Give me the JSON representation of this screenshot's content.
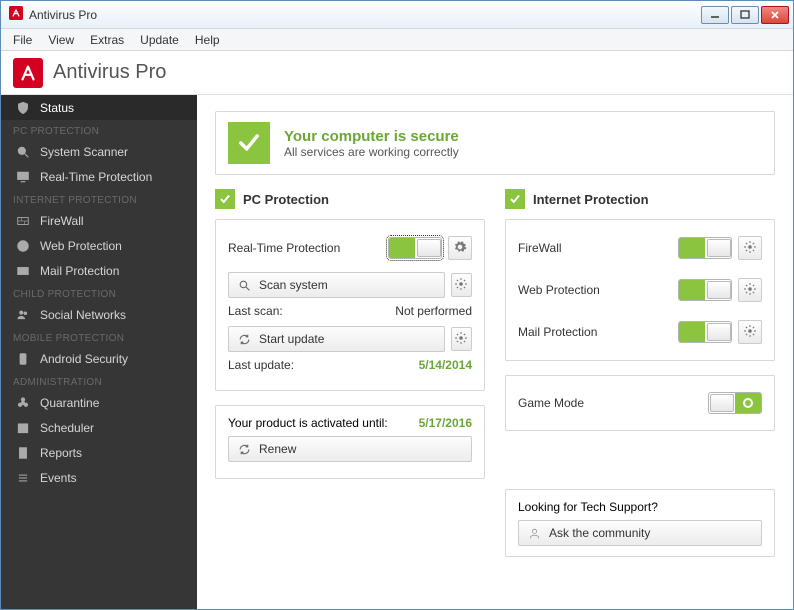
{
  "window": {
    "title": "Antivirus Pro"
  },
  "menubar": [
    "File",
    "View",
    "Extras",
    "Update",
    "Help"
  ],
  "header": {
    "app_name": "Antivirus Pro"
  },
  "sidebar": {
    "status_label": "Status",
    "sections": [
      {
        "title": "PC PROTECTION",
        "items": [
          "System Scanner",
          "Real-Time Protection"
        ]
      },
      {
        "title": "INTERNET PROTECTION",
        "items": [
          "FireWall",
          "Web Protection",
          "Mail Protection"
        ]
      },
      {
        "title": "CHILD PROTECTION",
        "items": [
          "Social Networks"
        ]
      },
      {
        "title": "MOBILE PROTECTION",
        "items": [
          "Android Security"
        ]
      },
      {
        "title": "ADMINISTRATION",
        "items": [
          "Quarantine",
          "Scheduler",
          "Reports",
          "Events"
        ]
      }
    ]
  },
  "status": {
    "title": "Your computer is secure",
    "subtitle": "All services are working correctly"
  },
  "pc": {
    "heading": "PC Protection",
    "realtime_label": "Real-Time Protection",
    "scan_btn": "Scan system",
    "last_scan_label": "Last scan:",
    "last_scan_value": "Not performed",
    "update_btn": "Start update",
    "last_update_label": "Last update:",
    "last_update_value": "5/14/2014"
  },
  "activation": {
    "label": "Your product is activated until:",
    "value": "5/17/2016",
    "renew_btn": "Renew"
  },
  "inet": {
    "heading": "Internet Protection",
    "firewall": "FireWall",
    "web": "Web Protection",
    "mail": "Mail Protection"
  },
  "game": {
    "label": "Game Mode"
  },
  "support": {
    "question": "Looking for Tech Support?",
    "btn": "Ask the community"
  }
}
